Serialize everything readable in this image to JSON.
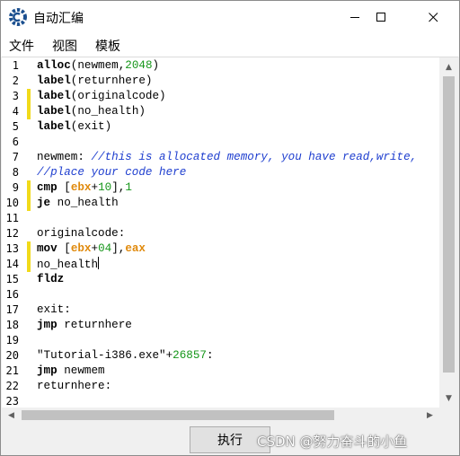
{
  "window": {
    "title": "自动汇编"
  },
  "menu": {
    "items": [
      "文件",
      "视图",
      "模板"
    ]
  },
  "editor": {
    "line_numbers": [
      "1",
      "2",
      "3",
      "4",
      "5",
      "6",
      "7",
      "8",
      "9",
      "10",
      "11",
      "12",
      "13",
      "14",
      "15",
      "16",
      "17",
      "18",
      "19",
      "20",
      "21",
      "22",
      "23"
    ],
    "changed_lines": [
      3,
      4,
      9,
      10,
      13,
      14
    ],
    "lines": [
      [
        {
          "t": "alloc",
          "c": "kw"
        },
        {
          "t": "(newmem,"
        },
        {
          "t": "2048",
          "c": "num"
        },
        {
          "t": ")"
        }
      ],
      [
        {
          "t": "label",
          "c": "kw"
        },
        {
          "t": "(returnhere)"
        }
      ],
      [
        {
          "t": "label",
          "c": "kw"
        },
        {
          "t": "(originalcode)"
        }
      ],
      [
        {
          "t": "label",
          "c": "kw"
        },
        {
          "t": "(no_health)"
        }
      ],
      [
        {
          "t": "label",
          "c": "kw"
        },
        {
          "t": "(exit)"
        }
      ],
      [],
      [
        {
          "t": "newmem: "
        },
        {
          "t": "//this is allocated memory, you have read,write,",
          "c": "cmt"
        }
      ],
      [
        {
          "t": "//place your code here",
          "c": "cmt"
        }
      ],
      [
        {
          "t": "cmp",
          "c": "kw"
        },
        {
          "t": " ["
        },
        {
          "t": "ebx",
          "c": "reg"
        },
        {
          "t": "+"
        },
        {
          "t": "10",
          "c": "num"
        },
        {
          "t": "],"
        },
        {
          "t": "1",
          "c": "num"
        }
      ],
      [
        {
          "t": "je",
          "c": "kw"
        },
        {
          "t": " no_health"
        }
      ],
      [],
      [
        {
          "t": "originalcode:"
        }
      ],
      [
        {
          "t": "mov",
          "c": "kw"
        },
        {
          "t": " ["
        },
        {
          "t": "ebx",
          "c": "reg"
        },
        {
          "t": "+"
        },
        {
          "t": "04",
          "c": "num"
        },
        {
          "t": "],"
        },
        {
          "t": "eax",
          "c": "reg"
        }
      ],
      [
        {
          "t": "no_health"
        },
        {
          "caret": true
        }
      ],
      [
        {
          "t": "fldz",
          "c": "kw"
        }
      ],
      [],
      [
        {
          "t": "exit:"
        }
      ],
      [
        {
          "t": "jmp",
          "c": "kw"
        },
        {
          "t": " returnhere"
        }
      ],
      [],
      [
        {
          "t": "\"Tutorial-i386.exe\"+"
        },
        {
          "t": "26857",
          "c": "num"
        },
        {
          "t": ":"
        }
      ],
      [
        {
          "t": "jmp",
          "c": "kw"
        },
        {
          "t": " newmem"
        }
      ],
      [
        {
          "t": "returnhere:"
        }
      ],
      []
    ]
  },
  "footer": {
    "execute_label": "执行",
    "watermark": "CSDN @努力奋斗的小鱼"
  },
  "colors": {
    "change_marker": "#f1da1a",
    "comment": "#1e3ecf",
    "number": "#16961a",
    "register": "#e08a0d"
  }
}
